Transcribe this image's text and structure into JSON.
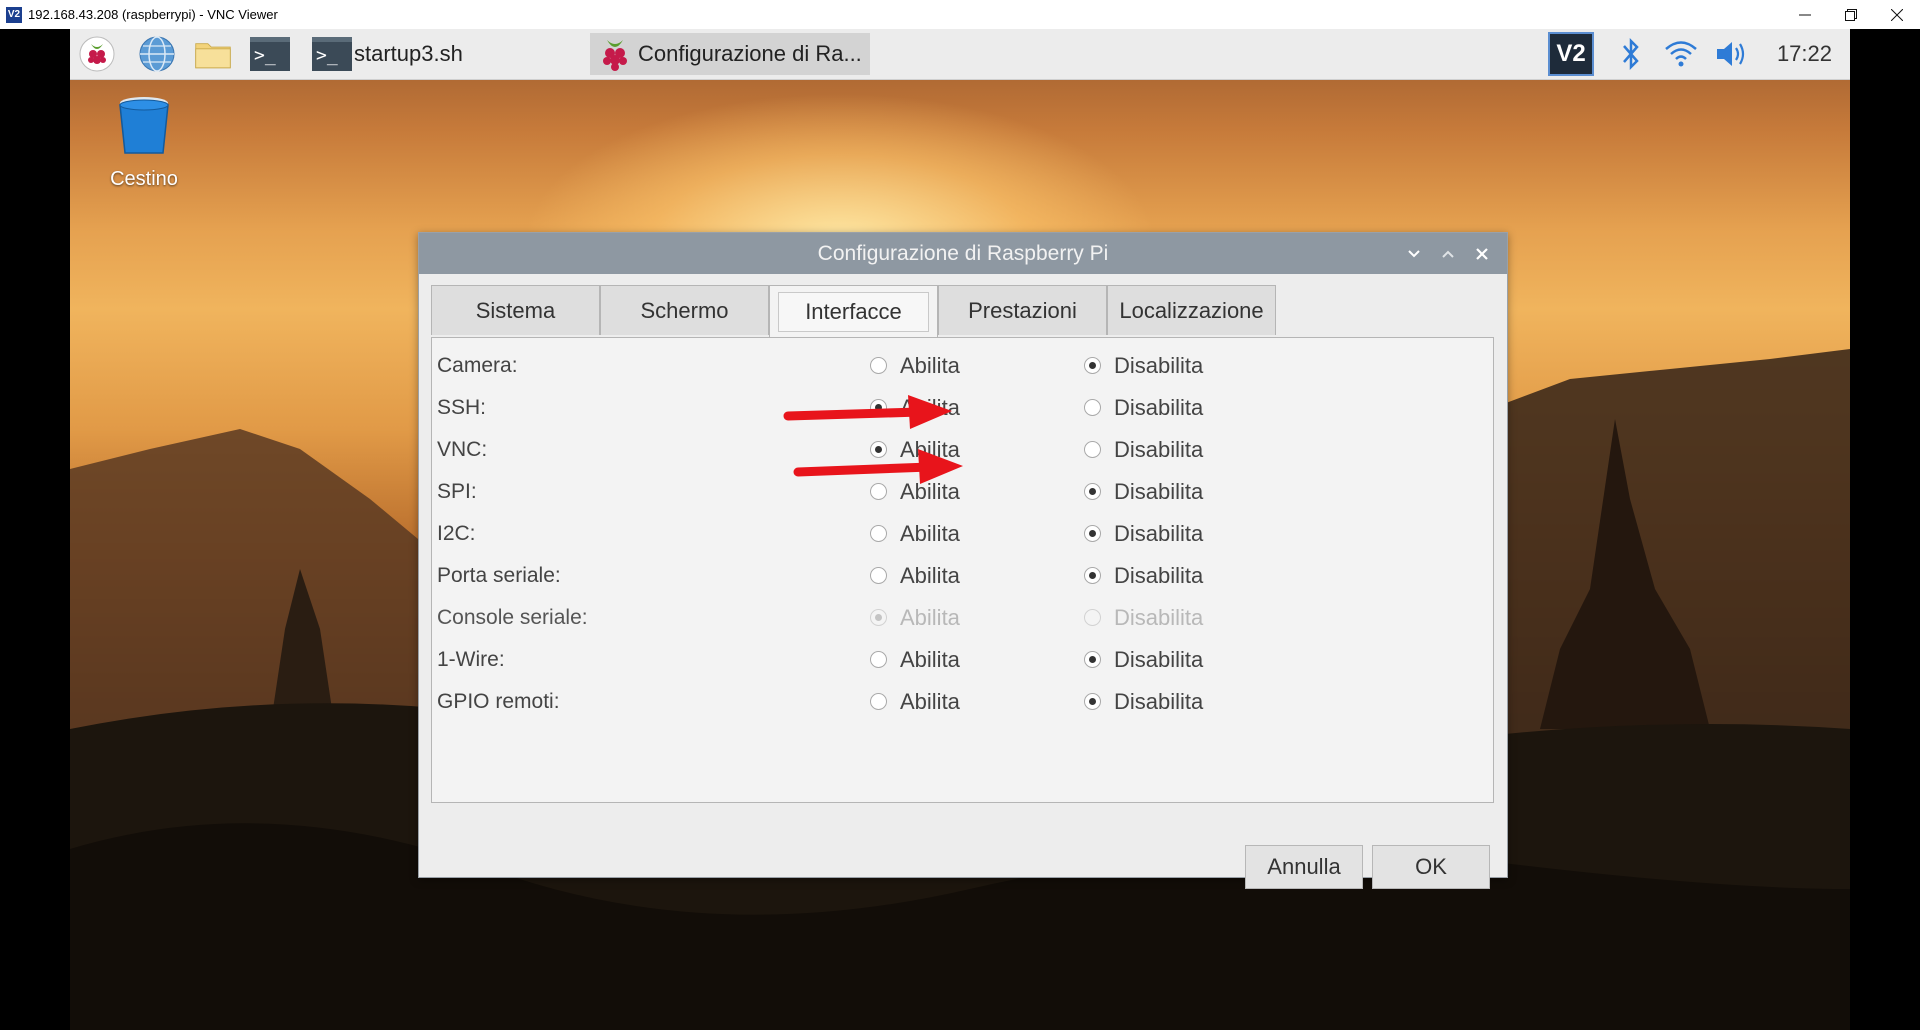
{
  "vnc": {
    "title": "192.168.43.208 (raspberrypi) - VNC Viewer",
    "logo": "V2",
    "minimize_icon": "minimize-icon",
    "restore_icon": "restore-icon",
    "close_icon": "close-icon"
  },
  "taskbar": {
    "launchers": [
      "raspberry-menu-icon",
      "web-browser-icon",
      "file-manager-icon",
      "terminal-icon"
    ],
    "tasks": [
      {
        "label": "startup3.sh",
        "icon": "terminal-icon",
        "active": false
      },
      {
        "label": "Configurazione di Ra...",
        "icon": "raspberry-icon",
        "active": true
      }
    ],
    "tray": [
      "vnc-server-icon",
      "bluetooth-icon",
      "wifi-icon",
      "volume-icon"
    ],
    "vnc_tray_text": "V2",
    "clock": "17:22"
  },
  "desktop": {
    "trash_label": "Cestino"
  },
  "dialog": {
    "title": "Configurazione di Raspberry Pi",
    "tabs": [
      "Sistema",
      "Schermo",
      "Interfacce",
      "Prestazioni",
      "Localizzazione"
    ],
    "active_tab": "Interfacce",
    "enable_label": "Abilita",
    "disable_label": "Disabilita",
    "rows": [
      {
        "label": "Camera:",
        "selected": "disable",
        "enabled": true
      },
      {
        "label": "SSH:",
        "selected": "enable",
        "enabled": true
      },
      {
        "label": "VNC:",
        "selected": "enable",
        "enabled": true
      },
      {
        "label": "SPI:",
        "selected": "disable",
        "enabled": true
      },
      {
        "label": "I2C:",
        "selected": "disable",
        "enabled": true
      },
      {
        "label": "Porta seriale:",
        "selected": "disable",
        "enabled": true
      },
      {
        "label": "Console seriale:",
        "selected": "enable",
        "enabled": false
      },
      {
        "label": "1-Wire:",
        "selected": "disable",
        "enabled": true
      },
      {
        "label": "GPIO remoti:",
        "selected": "disable",
        "enabled": true
      }
    ],
    "cancel_label": "Annulla",
    "ok_label": "OK"
  },
  "annotations": {
    "arrow_color": "#e8141b",
    "arrows_point_to": [
      "SSH",
      "VNC"
    ]
  }
}
